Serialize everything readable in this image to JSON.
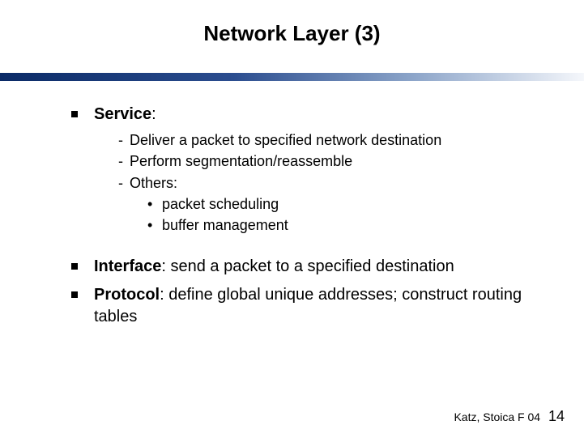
{
  "title": "Network Layer (3)",
  "bullets": [
    {
      "heading": "Service",
      "rest": ":",
      "sub": [
        "Deliver a packet to specified network destination",
        "Perform segmentation/reassemble",
        "Others:"
      ],
      "sub2": [
        "packet scheduling",
        "buffer management"
      ]
    },
    {
      "heading": "Interface",
      "rest": ": send a packet to a specified destination"
    },
    {
      "heading": "Protocol",
      "rest": ": define global unique addresses; construct routing tables"
    }
  ],
  "footer": {
    "credit": "Katz, Stoica F 04",
    "page": "14"
  }
}
